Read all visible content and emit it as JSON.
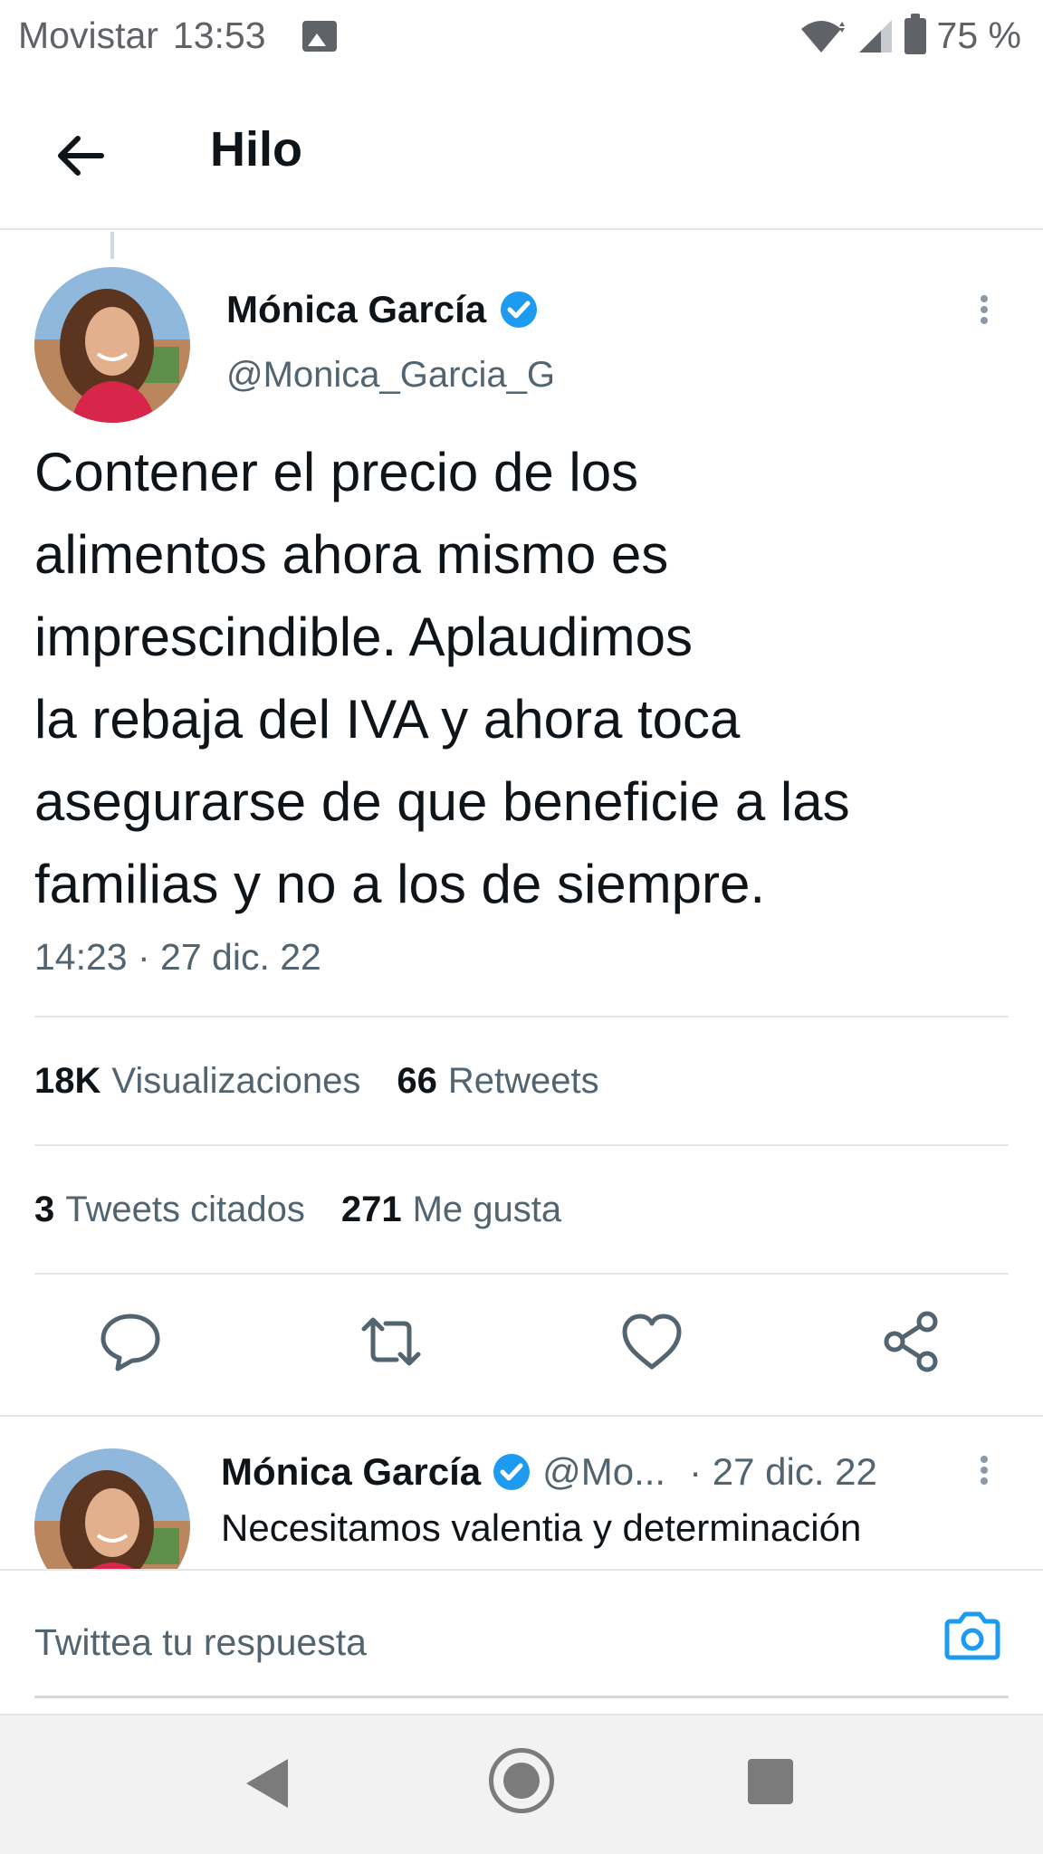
{
  "status_bar": {
    "carrier": "Movistar",
    "time": "13:53",
    "battery": "75 %",
    "icons": [
      "image-notification-icon",
      "wifi-icon",
      "signal-icon",
      "battery-icon"
    ]
  },
  "header": {
    "title": "Hilo",
    "back_icon": "arrow-left-icon"
  },
  "tweet": {
    "author_name": "Mónica García",
    "author_handle": "@Monica_Garcia_G",
    "text": "Contener el precio de los\nalimentos ahora mismo es\nimprescindible. Aplaudimos\nla rebaja del IVA y ahora toca\nasegurarse de que beneficie a las\nfamilias y no a los de siempre.",
    "timestamp": "14:23 · 27 dic. 22",
    "stats": {
      "views_count": "18K",
      "views_label": "Visualizaciones",
      "retweets_count": "66",
      "retweets_label": "Retweets",
      "quotes_count": "3",
      "quotes_label": "Tweets citados",
      "likes_count": "271",
      "likes_label": "Me gusta"
    },
    "actions": [
      "reply-icon",
      "retweet-icon",
      "like-icon",
      "share-icon"
    ]
  },
  "reply_tweet": {
    "author_name": "Mónica García",
    "author_handle": "@Mo...",
    "date": "· 27 dic. 22",
    "text": "Necesitamos valentia y determinación"
  },
  "composer": {
    "placeholder": "Twittea tu respuesta"
  },
  "colors": {
    "accent": "#1d9bf0",
    "text_primary": "#0f1419",
    "text_secondary": "#536471",
    "divider": "#e1e8ed"
  }
}
